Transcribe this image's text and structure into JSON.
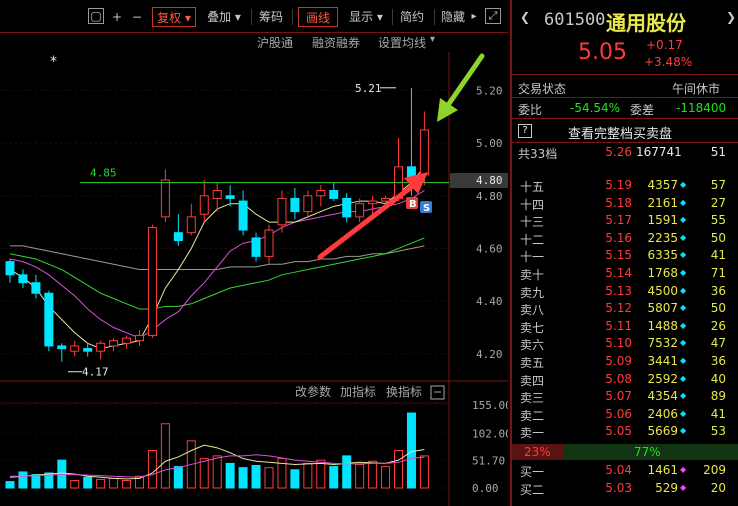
{
  "toolbar": {
    "fuquan": "复权",
    "diejia": "叠加",
    "choumа": "筹码",
    "huaxian": "画线",
    "xianshi": "显示",
    "jianyue": "简约",
    "yincang": "隐藏"
  },
  "subbar": {
    "hugutong": "沪股通",
    "rongzi": "融资融券",
    "shezhi": "设置均线"
  },
  "indicator_bar": {
    "gaicanshu": "改参数",
    "jiazhibiao": "加指标",
    "huanzhibiao": "换指标"
  },
  "stock": {
    "code": "601500",
    "name": "通用股份",
    "price": "5.05",
    "change": "+0.17",
    "change_pct": "+3.48%"
  },
  "status": {
    "label": "交易状态",
    "value": "午间休市"
  },
  "weibi": {
    "label": "委比",
    "value": "-54.54%",
    "cha_label": "委差",
    "cha_value": "-118400"
  },
  "full_book": {
    "help": "?",
    "label": "查看完整档买卖盘"
  },
  "gong": {
    "label": "共33档",
    "price": "5.26",
    "vol": "167741",
    "cnt": "51"
  },
  "asks": [
    {
      "name": "十五",
      "price": "5.19",
      "vol": "4357",
      "cnt": "57"
    },
    {
      "name": "十四",
      "price": "5.18",
      "vol": "2161",
      "cnt": "27"
    },
    {
      "name": "十三",
      "price": "5.17",
      "vol": "1591",
      "cnt": "55"
    },
    {
      "name": "十二",
      "price": "5.16",
      "vol": "2235",
      "cnt": "50"
    },
    {
      "name": "十一",
      "price": "5.15",
      "vol": "6335",
      "cnt": "41"
    },
    {
      "name": "卖十",
      "price": "5.14",
      "vol": "1768",
      "cnt": "71"
    },
    {
      "name": "卖九",
      "price": "5.13",
      "vol": "4500",
      "cnt": "36"
    },
    {
      "name": "卖八",
      "price": "5.12",
      "vol": "5807",
      "cnt": "50"
    },
    {
      "name": "卖七",
      "price": "5.11",
      "vol": "1488",
      "cnt": "26"
    },
    {
      "name": "卖六",
      "price": "5.10",
      "vol": "7532",
      "cnt": "47"
    },
    {
      "name": "卖五",
      "price": "5.09",
      "vol": "3441",
      "cnt": "36"
    },
    {
      "name": "卖四",
      "price": "5.08",
      "vol": "2592",
      "cnt": "40"
    },
    {
      "name": "卖三",
      "price": "5.07",
      "vol": "4354",
      "cnt": "89"
    },
    {
      "name": "卖二",
      "price": "5.06",
      "vol": "2406",
      "cnt": "41"
    },
    {
      "name": "卖一",
      "price": "5.05",
      "vol": "5669",
      "cnt": "53"
    }
  ],
  "ratio": {
    "sell": "23%",
    "buy": "77%"
  },
  "bids": [
    {
      "name": "买一",
      "price": "5.04",
      "vol": "1461",
      "cnt": "209"
    },
    {
      "name": "买二",
      "price": "5.03",
      "vol": "529",
      "cnt": "20"
    }
  ],
  "price_axis": [
    "5.20",
    "5.00",
    "4.80",
    "4.60",
    "4.40",
    "4.20"
  ],
  "vol_axis": [
    "155.00",
    "102.00",
    "51.70",
    "0.00"
  ],
  "annotations": {
    "high": "5.21",
    "low": "4.17",
    "level": "4.85",
    "current_tag": "4.80",
    "b_marker": "B",
    "s_marker": "S",
    "star": "*"
  },
  "colors": {
    "up": "#ff3b3b",
    "down": "#00e5ff",
    "panel_border": "#7a1414",
    "annotation_arrow_green": "#8fd42b",
    "annotation_arrow_red": "#ff3b3b"
  },
  "chart_data": {
    "type": "candlestick",
    "ylim": [
      4.15,
      5.27
    ],
    "candles": [
      {
        "o": 4.55,
        "h": 4.56,
        "l": 4.47,
        "c": 4.5
      },
      {
        "o": 4.5,
        "h": 4.52,
        "l": 4.45,
        "c": 4.47
      },
      {
        "o": 4.47,
        "h": 4.5,
        "l": 4.41,
        "c": 4.43
      },
      {
        "o": 4.43,
        "h": 4.44,
        "l": 4.21,
        "c": 4.23
      },
      {
        "o": 4.23,
        "h": 4.24,
        "l": 4.17,
        "c": 4.22
      },
      {
        "o": 4.21,
        "h": 4.25,
        "l": 4.19,
        "c": 4.23
      },
      {
        "o": 4.22,
        "h": 4.24,
        "l": 4.19,
        "c": 4.21
      },
      {
        "o": 4.21,
        "h": 4.25,
        "l": 4.18,
        "c": 4.24
      },
      {
        "o": 4.23,
        "h": 4.26,
        "l": 4.21,
        "c": 4.25
      },
      {
        "o": 4.24,
        "h": 4.27,
        "l": 4.22,
        "c": 4.26
      },
      {
        "o": 4.25,
        "h": 4.29,
        "l": 4.23,
        "c": 4.27
      },
      {
        "o": 4.27,
        "h": 4.69,
        "l": 4.26,
        "c": 4.68
      },
      {
        "o": 4.72,
        "h": 4.9,
        "l": 4.7,
        "c": 4.86
      },
      {
        "o": 4.66,
        "h": 4.73,
        "l": 4.61,
        "c": 4.63
      },
      {
        "o": 4.66,
        "h": 4.77,
        "l": 4.65,
        "c": 4.72
      },
      {
        "o": 4.73,
        "h": 4.86,
        "l": 4.7,
        "c": 4.8
      },
      {
        "o": 4.79,
        "h": 4.85,
        "l": 4.74,
        "c": 4.82
      },
      {
        "o": 4.8,
        "h": 4.84,
        "l": 4.76,
        "c": 4.79
      },
      {
        "o": 4.78,
        "h": 4.82,
        "l": 4.65,
        "c": 4.67
      },
      {
        "o": 4.64,
        "h": 4.66,
        "l": 4.55,
        "c": 4.57
      },
      {
        "o": 4.57,
        "h": 4.69,
        "l": 4.54,
        "c": 4.67
      },
      {
        "o": 4.69,
        "h": 4.82,
        "l": 4.66,
        "c": 4.79
      },
      {
        "o": 4.79,
        "h": 4.83,
        "l": 4.71,
        "c": 4.74
      },
      {
        "o": 4.74,
        "h": 4.82,
        "l": 4.72,
        "c": 4.8
      },
      {
        "o": 4.8,
        "h": 4.84,
        "l": 4.76,
        "c": 4.82
      },
      {
        "o": 4.82,
        "h": 4.85,
        "l": 4.78,
        "c": 4.79
      },
      {
        "o": 4.79,
        "h": 4.81,
        "l": 4.7,
        "c": 4.72
      },
      {
        "o": 4.72,
        "h": 4.79,
        "l": 4.7,
        "c": 4.77
      },
      {
        "o": 4.77,
        "h": 4.8,
        "l": 4.73,
        "c": 4.78
      },
      {
        "o": 4.78,
        "h": 4.8,
        "l": 4.75,
        "c": 4.79
      },
      {
        "o": 4.79,
        "h": 5.02,
        "l": 4.78,
        "c": 4.91
      },
      {
        "o": 4.91,
        "h": 5.21,
        "l": 4.8,
        "c": 4.87
      },
      {
        "o": 4.88,
        "h": 5.12,
        "l": 4.84,
        "c": 5.05
      }
    ],
    "volumes": [
      12,
      30,
      25,
      28,
      52,
      14,
      20,
      16,
      18,
      14,
      22,
      70,
      120,
      40,
      88,
      55,
      60,
      46,
      38,
      42,
      38,
      55,
      34,
      46,
      52,
      40,
      60,
      44,
      50,
      40,
      70,
      140,
      60
    ],
    "ma5": [
      4.52,
      4.49,
      4.45,
      4.38,
      4.33,
      4.28,
      4.24,
      4.22,
      4.23,
      4.24,
      4.25,
      4.34,
      4.45,
      4.52,
      4.6,
      4.7,
      4.75,
      4.77,
      4.77,
      4.73,
      4.7,
      4.7,
      4.7,
      4.72,
      4.74,
      4.76,
      4.77,
      4.78,
      4.78,
      4.77,
      4.81,
      4.85,
      4.91
    ],
    "ma10": [
      4.56,
      4.55,
      4.53,
      4.5,
      4.46,
      4.42,
      4.37,
      4.33,
      4.3,
      4.28,
      4.26,
      4.29,
      4.33,
      4.36,
      4.42,
      4.47,
      4.53,
      4.59,
      4.62,
      4.63,
      4.65,
      4.68,
      4.7,
      4.71,
      4.72,
      4.73,
      4.74,
      4.74,
      4.75,
      4.76,
      4.77,
      4.79,
      4.82
    ],
    "ma20": [
      4.58,
      4.57,
      4.56,
      4.54,
      4.52,
      4.49,
      4.46,
      4.43,
      4.41,
      4.39,
      4.37,
      4.37,
      4.38,
      4.38,
      4.39,
      4.41,
      4.43,
      4.45,
      4.46,
      4.47,
      4.48,
      4.5,
      4.51,
      4.52,
      4.53,
      4.54,
      4.55,
      4.56,
      4.57,
      4.58,
      4.6,
      4.62,
      4.64
    ],
    "ma60": [
      4.61,
      4.61,
      4.6,
      4.59,
      4.58,
      4.57,
      4.56,
      4.55,
      4.54,
      4.53,
      4.52,
      4.52,
      4.52,
      4.52,
      4.52,
      4.52,
      4.52,
      4.53,
      4.53,
      4.53,
      4.54,
      4.54,
      4.55,
      4.55,
      4.56,
      4.56,
      4.57,
      4.57,
      4.58,
      4.58,
      4.59,
      4.6,
      4.61
    ],
    "vol_ma5": [
      20,
      22,
      24,
      26,
      28,
      26,
      22,
      20,
      18,
      17,
      18,
      28,
      50,
      58,
      70,
      80,
      75,
      66,
      55,
      50,
      48,
      46,
      44,
      45,
      46,
      44,
      46,
      48,
      47,
      46,
      52,
      68,
      72
    ],
    "vol_ma10": [
      22,
      22,
      23,
      24,
      25,
      25,
      24,
      23,
      22,
      21,
      20,
      25,
      34,
      38,
      44,
      50,
      56,
      60,
      60,
      62,
      60,
      56,
      52,
      50,
      48,
      46,
      45,
      45,
      46,
      46,
      48,
      55,
      58
    ]
  }
}
